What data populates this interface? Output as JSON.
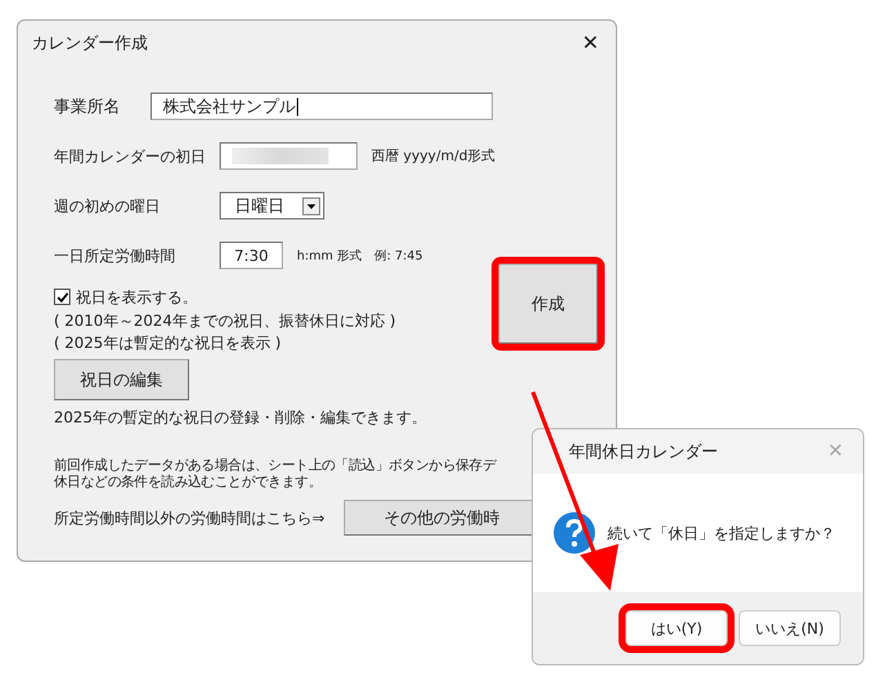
{
  "window": {
    "title": "カレンダー作成",
    "close": "✕"
  },
  "fields": [
    {
      "kind": "text",
      "label": "事業所名",
      "value": "株式会社サンプル"
    },
    {
      "kind": "blurred",
      "label": "年間カレンダーの初日",
      "suffix": "西暦 yyyy/m/d形式"
    },
    {
      "kind": "select",
      "label": "週の初めの曜日",
      "value": "日曜日"
    },
    {
      "kind": "time",
      "label": "一日所定労働時間",
      "value": "7:30",
      "suffix": "h:mm 形式　例:  7:45"
    }
  ],
  "holiday_checkbox": {
    "label": "祝日を表示する。",
    "checked": true
  },
  "notes": [
    "( 2010年～2024年までの祝日、振替休日に対応 )",
    "( 2025年は暫定的な祝日を表示 )"
  ],
  "edit_button": {
    "label": "祝日の編集"
  },
  "edit_note": "2025年の暫定的な祝日の登録・削除・編集できます。",
  "create_button": {
    "label": "作成",
    "highlighted": true
  },
  "load_note": [
    "前回作成したデータがある場合は、シート上の「読込」ボタンから保存デ",
    "休日などの条件を読み込むことができます。"
  ],
  "other_hours": {
    "text": "所定労働時間以外の労働時間はこちら⇒",
    "button": "その他の労働時"
  },
  "dialog": {
    "title": "年間休日カレンダー",
    "close": "✕",
    "message": "続いて「休日」を指定しますか？",
    "buttons": [
      {
        "label": "はい(Y)",
        "highlighted": true
      },
      {
        "label": "いいえ(N)",
        "highlighted": false
      }
    ]
  }
}
